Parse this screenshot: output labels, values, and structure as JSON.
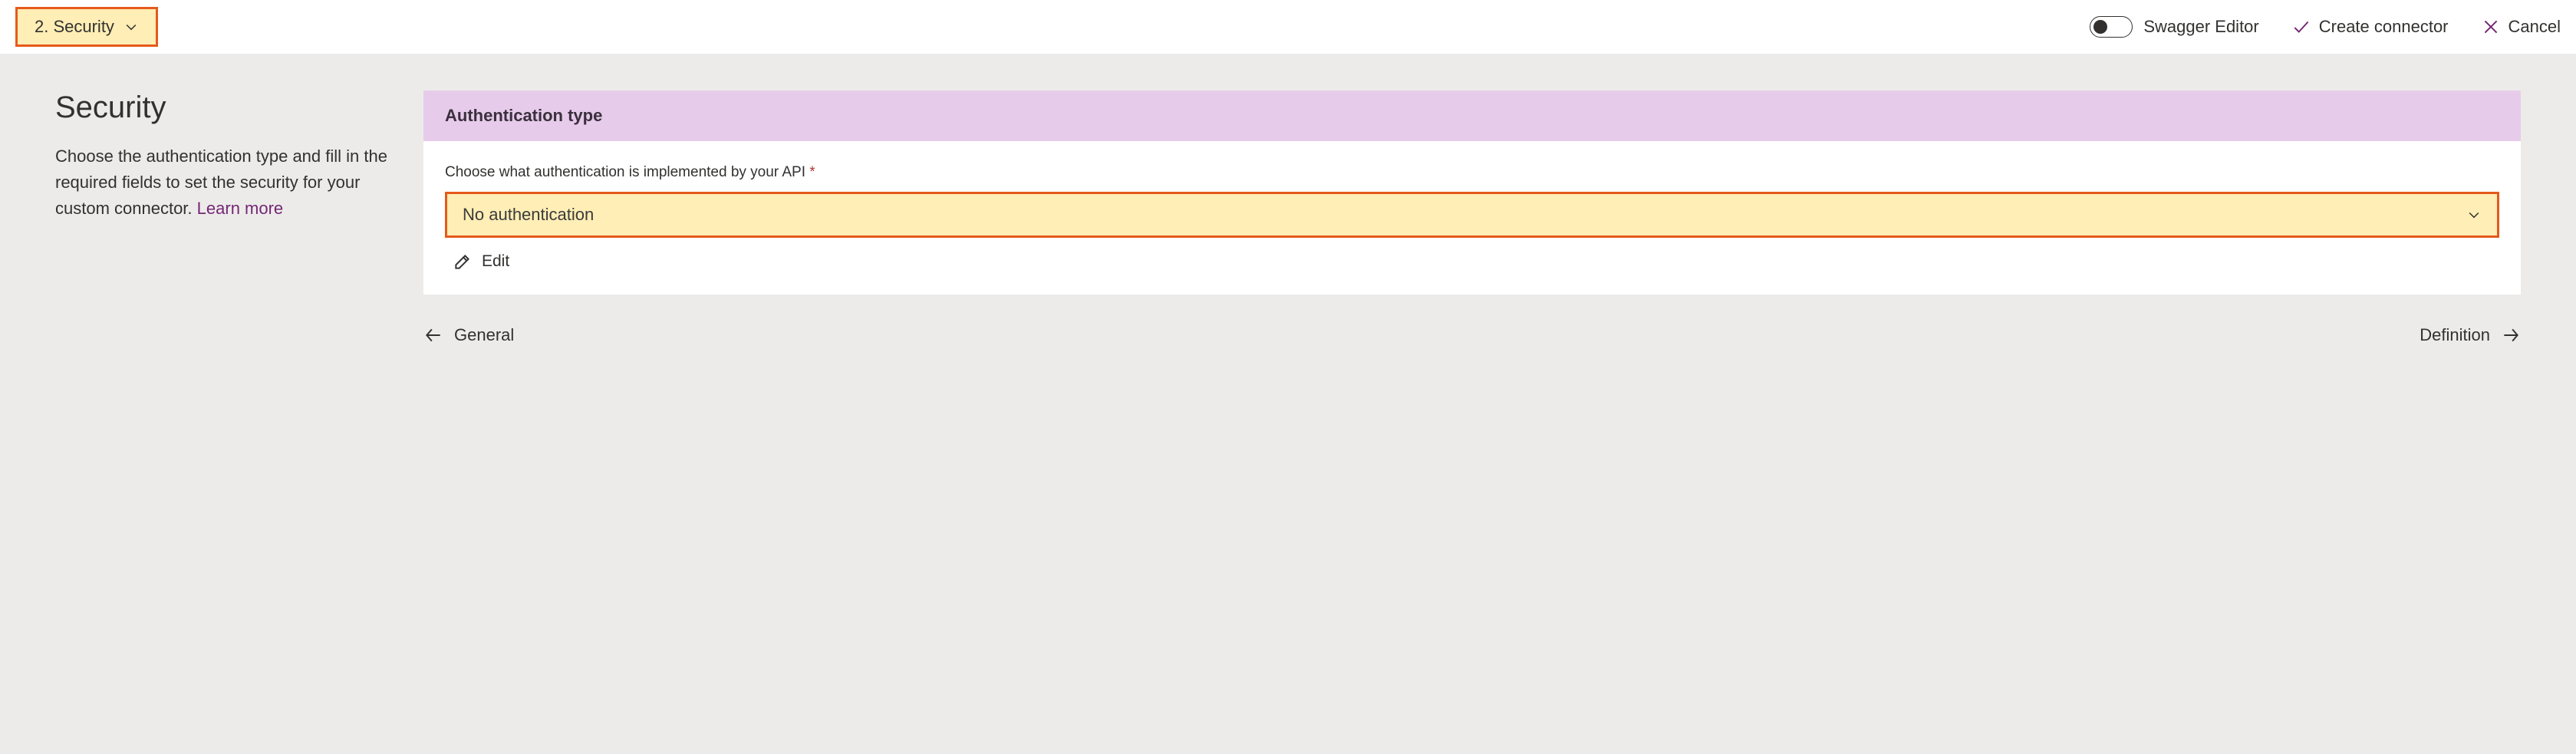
{
  "topbar": {
    "step_label": "2. Security",
    "swagger_label": "Swagger Editor",
    "create_label": "Create connector",
    "cancel_label": "Cancel"
  },
  "side": {
    "heading": "Security",
    "description_pre": "Choose the authentication type and fill in the required fields to set the security for your custom connector. ",
    "learn_more": "Learn more"
  },
  "card": {
    "header": "Authentication type",
    "field_label": "Choose what authentication is implemented by your API",
    "required_mark": "*",
    "select_value": "No authentication",
    "edit_label": "Edit"
  },
  "footnav": {
    "prev": "General",
    "next": "Definition"
  }
}
